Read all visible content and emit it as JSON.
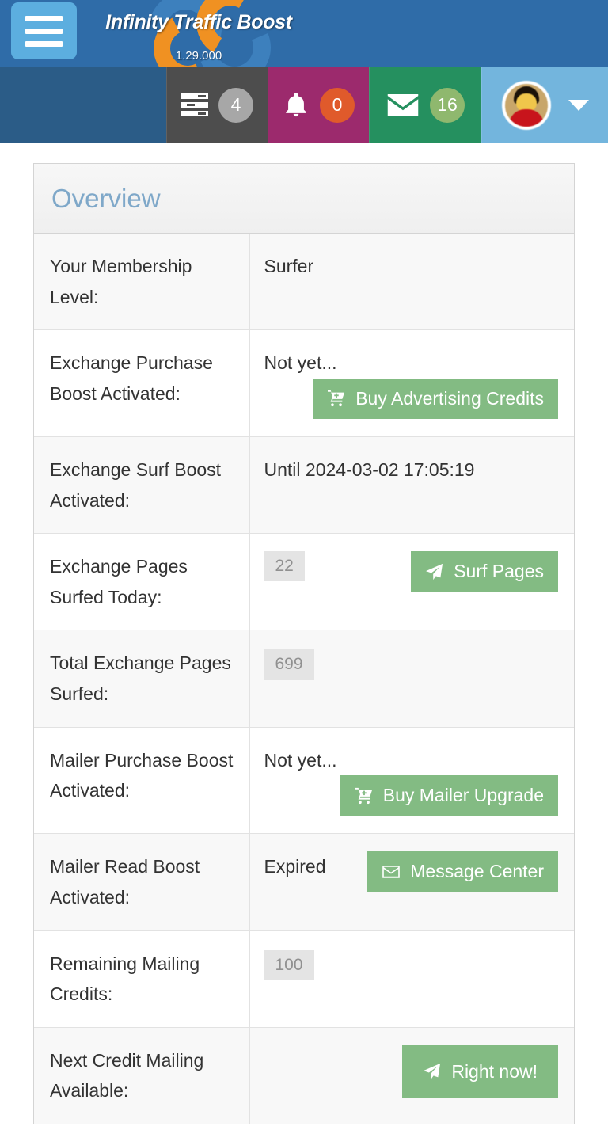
{
  "header": {
    "menu_icon": "hamburger-menu-icon",
    "brand_name": "Infinity Traffic Boost",
    "version": "1.29.000",
    "bg_color": "#2f6ca8"
  },
  "navbar": {
    "bg_color": "#2b5c87",
    "items": [
      {
        "name": "tasks",
        "icon": "tasks-icon",
        "badge": "4",
        "bg": "#4d4d4d",
        "badge_bg": "#a7a7a7"
      },
      {
        "name": "notifications",
        "icon": "bell-icon",
        "badge": "0",
        "bg": "#9c2a6d",
        "badge_bg": "#e05a2b"
      },
      {
        "name": "messages",
        "icon": "envelope-icon",
        "badge": "16",
        "bg": "#25905f",
        "badge_bg": "#8fb86e"
      },
      {
        "name": "account",
        "icon": "user-avatar-icon",
        "badge": "",
        "bg": "#73b5dd",
        "badge_bg": ""
      }
    ]
  },
  "panel": {
    "title": "Overview",
    "title_color": "#7fa8c9",
    "button_color": "#83bb83",
    "rows": [
      {
        "label": "Your Membership Level:",
        "value": "Surfer",
        "chip": "",
        "button": "",
        "button_icon": ""
      },
      {
        "label": "Exchange Purchase Boost Activated:",
        "value": "Not yet...",
        "chip": "",
        "button": "Buy Advertising Credits",
        "button_icon": "cart-plus-icon"
      },
      {
        "label": "Exchange Surf Boost Activated:",
        "value": "Until 2024-03-02 17:05:19",
        "chip": "",
        "button": "",
        "button_icon": ""
      },
      {
        "label": "Exchange Pages Surfed Today:",
        "value": "",
        "chip": "22",
        "button": "Surf Pages",
        "button_icon": "paper-plane-icon"
      },
      {
        "label": "Total Exchange Pages Surfed:",
        "value": "",
        "chip": "699",
        "button": "",
        "button_icon": ""
      },
      {
        "label": "Mailer Purchase Boost Activated:",
        "value": "Not yet...",
        "chip": "",
        "button": "Buy Mailer Upgrade",
        "button_icon": "cart-plus-icon"
      },
      {
        "label": "Mailer Read Boost Activated:",
        "value": "Expired",
        "chip": "",
        "button": "Message Center",
        "button_icon": "envelope-open-icon"
      },
      {
        "label": "Remaining Mailing Credits:",
        "value": "",
        "chip": "100",
        "button": "",
        "button_icon": ""
      },
      {
        "label": "Next Credit Mailing Available:",
        "value": "",
        "chip": "",
        "button": "Right now!",
        "button_icon": "paper-plane-icon"
      }
    ]
  }
}
